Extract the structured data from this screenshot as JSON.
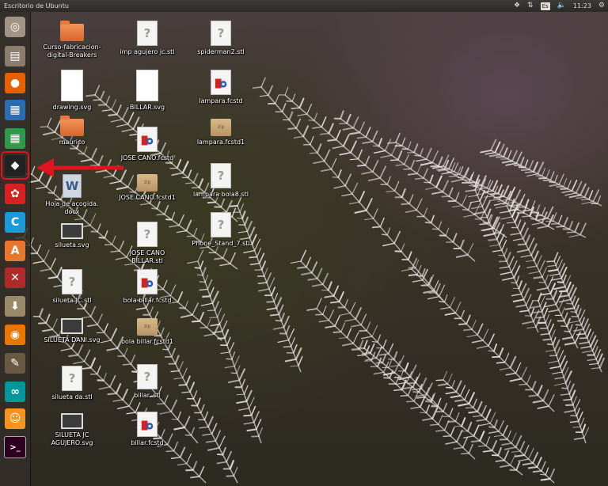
{
  "top_panel": {
    "title": "Escritorio de Ubuntu",
    "keyboard_layout": "Es",
    "clock": "11:23"
  },
  "launcher": {
    "items": [
      {
        "name": "ubuntu-dash",
        "icon": "ubuntu-logo-icon",
        "color": "#7e6f5f"
      },
      {
        "name": "files",
        "icon": "file-cabinet-icon",
        "color": "#8b7e6e"
      },
      {
        "name": "firefox",
        "icon": "firefox-icon",
        "color": "#e66000"
      },
      {
        "name": "libreoffice-writer",
        "icon": "writer-document-icon",
        "color": "#2a6db3"
      },
      {
        "name": "libreoffice-calc",
        "icon": "calc-spreadsheet-icon",
        "color": "#2f9b4a"
      },
      {
        "name": "inkscape",
        "icon": "inkscape-icon",
        "color": "#222222",
        "highlighted": true
      },
      {
        "name": "freecad",
        "icon": "freecad-icon",
        "color": "#d7201f"
      },
      {
        "name": "cura",
        "icon": "cura-icon",
        "color": "#1a9ad7"
      },
      {
        "name": "software-center",
        "icon": "software-center-icon",
        "color": "#e8772e"
      },
      {
        "name": "system-settings",
        "icon": "settings-wrench-icon",
        "color": "#b02a2a"
      },
      {
        "name": "downloads",
        "icon": "download-folder-icon",
        "color": "#9b8a6a"
      },
      {
        "name": "blender",
        "icon": "blender-icon",
        "color": "#ea7600"
      },
      {
        "name": "gimp",
        "icon": "gimp-icon",
        "color": "#6b5a43"
      },
      {
        "name": "arduino",
        "icon": "arduino-icon",
        "color": "#00979c"
      },
      {
        "name": "scratch",
        "icon": "scratch-cat-icon",
        "color": "#f7931e"
      },
      {
        "name": "terminal",
        "icon": "terminal-icon",
        "color": "#2c001e"
      }
    ]
  },
  "desktop": {
    "icons": [
      {
        "label": "Curso-fabricacion-digital-Breakers",
        "type": "folder"
      },
      {
        "label": "imp agujero jc.stl",
        "type": "unknown"
      },
      {
        "label": "spiderman2.stl",
        "type": "unknown"
      },
      {
        "label": "drawing.svg",
        "type": "blank"
      },
      {
        "label": "BILLAR.svg",
        "type": "blank"
      },
      {
        "label": "lampara.fcstd",
        "type": "freecad"
      },
      {
        "label": "maurico",
        "type": "folder"
      },
      {
        "label": "JOSE CANO.fcstd",
        "type": "freecad"
      },
      {
        "label": "lampara.fcstd1",
        "type": "zip"
      },
      {
        "label": "Hoja de acogida. docx",
        "type": "word"
      },
      {
        "label": "JOSE CANO.fcstd1",
        "type": "zip"
      },
      {
        "label": "lampara bola8.stl",
        "type": "unknown"
      },
      {
        "label": "Phone_Stand_7.stl",
        "type": "unknown"
      },
      {
        "label": "silueta.svg",
        "type": "monitor"
      },
      {
        "label": "JOSE CANO BILLAR.stl",
        "type": "unknown"
      },
      {
        "label": "silueta JC.stl",
        "type": "unknown"
      },
      {
        "label": "bola billar.fcstd",
        "type": "freecad"
      },
      {
        "label": "SILUETA DANI.svg",
        "type": "monitor"
      },
      {
        "label": "bola billar.fcstd1",
        "type": "zip"
      },
      {
        "label": "silueta da.stl",
        "type": "unknown"
      },
      {
        "label": "billar..stl",
        "type": "unknown"
      },
      {
        "label": "SILUETA JC AGUJERO.svg",
        "type": "monitor"
      },
      {
        "label": "billar.fcstd",
        "type": "freecad"
      }
    ],
    "zip_badge": "zip"
  },
  "annotation": {
    "arrow_color": "#e0141c",
    "highlight_color": "#e0141c"
  }
}
